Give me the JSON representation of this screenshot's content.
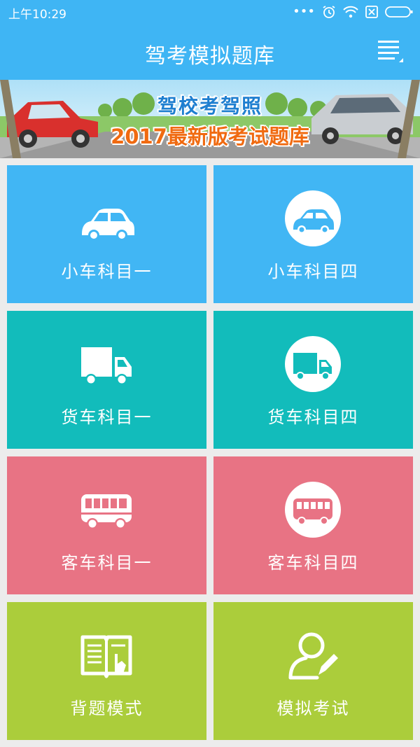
{
  "status_bar": {
    "time": "上午10:29"
  },
  "app_bar": {
    "title": "驾考模拟题库"
  },
  "banner": {
    "line1": "驾校考驾照",
    "line2": "2017最新版考试题库"
  },
  "tiles": [
    {
      "label": "小车科目一",
      "icon": "car-icon"
    },
    {
      "label": "小车科目四",
      "icon": "car-circle-icon"
    },
    {
      "label": "货车科目一",
      "icon": "truck-icon"
    },
    {
      "label": "货车科目四",
      "icon": "truck-circle-icon"
    },
    {
      "label": "客车科目一",
      "icon": "bus-icon"
    },
    {
      "label": "客车科目四",
      "icon": "bus-circle-icon"
    },
    {
      "label": "背题模式",
      "icon": "book-icon"
    },
    {
      "label": "模拟考试",
      "icon": "user-edit-icon"
    }
  ],
  "colors": {
    "primary": "#3fb5f4",
    "tile_blue": "#41b6f4",
    "tile_teal": "#12bcbb",
    "tile_pink": "#e87384",
    "tile_green": "#abcd3b"
  }
}
